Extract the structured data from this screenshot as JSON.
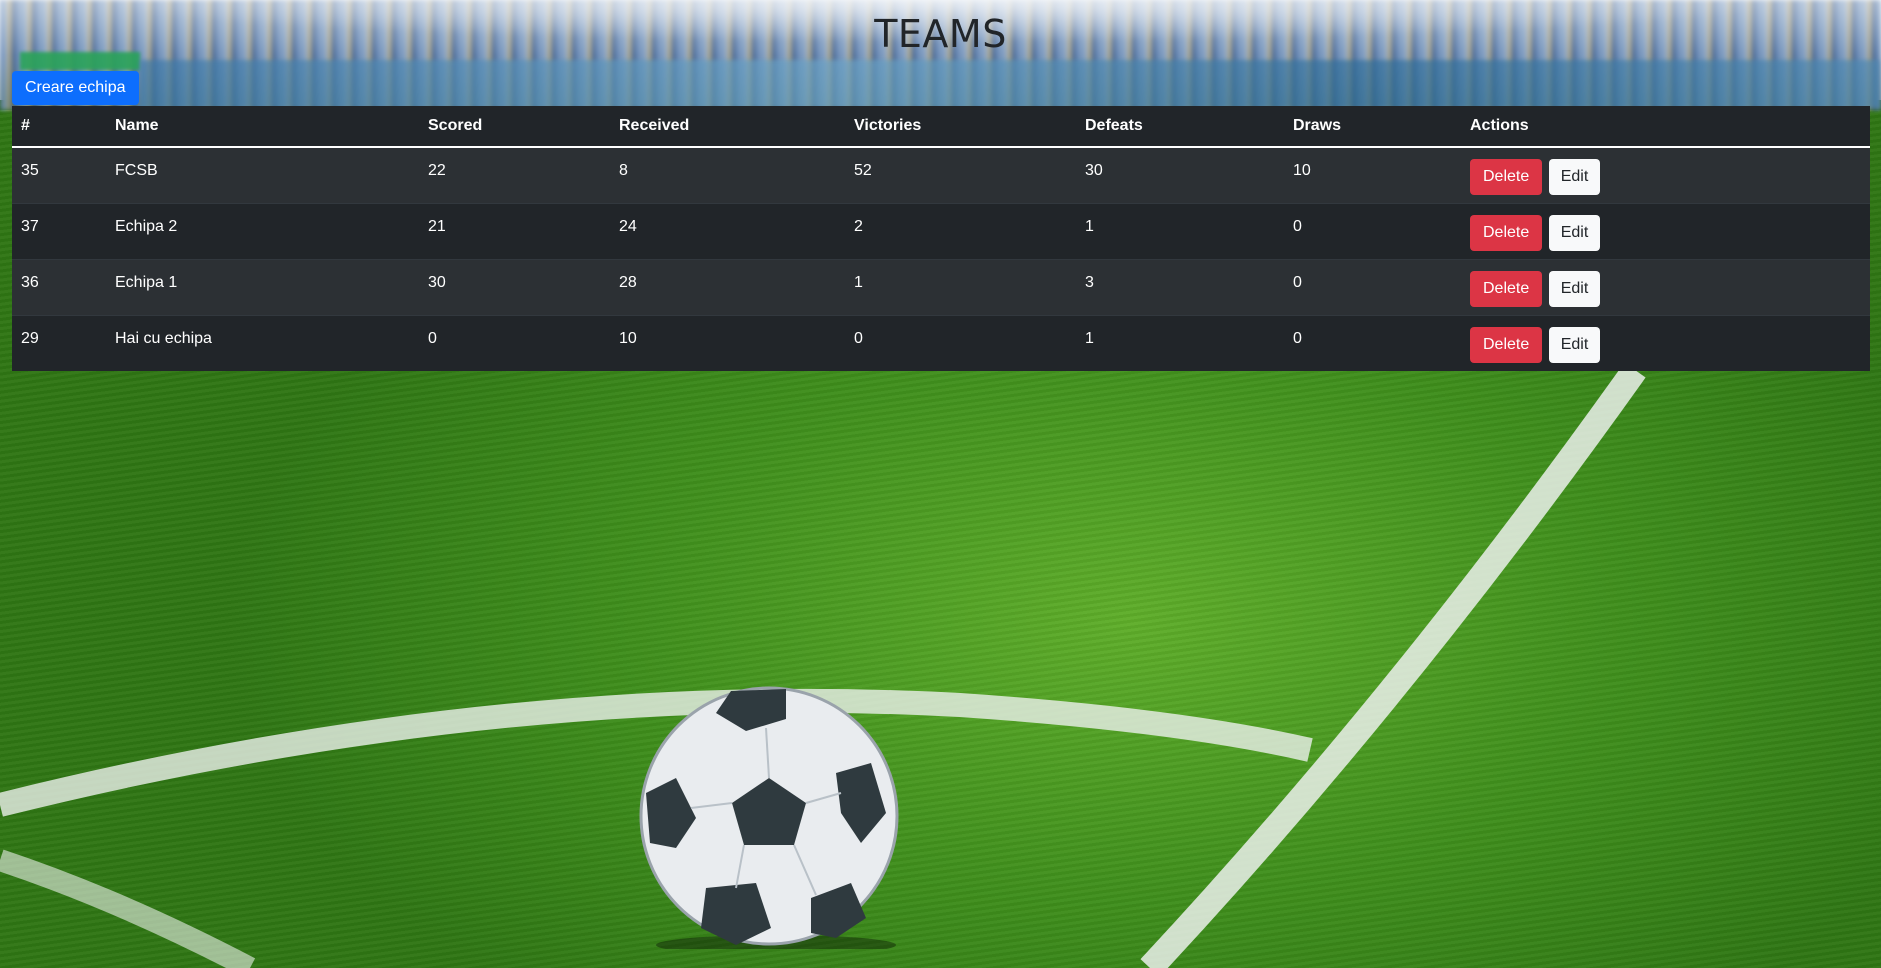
{
  "page": {
    "title": "TEAMS",
    "create_button_label": "Creare echipa"
  },
  "table": {
    "headers": [
      "#",
      "Name",
      "Scored",
      "Received",
      "Victories",
      "Defeats",
      "Draws",
      "Actions"
    ],
    "rows": [
      {
        "id": "35",
        "name": "FCSB",
        "scored": "22",
        "received": "8",
        "victories": "52",
        "defeats": "30",
        "draws": "10"
      },
      {
        "id": "37",
        "name": "Echipa 2",
        "scored": "21",
        "received": "24",
        "victories": "2",
        "defeats": "1",
        "draws": "0"
      },
      {
        "id": "36",
        "name": "Echipa 1",
        "scored": "30",
        "received": "28",
        "victories": "1",
        "defeats": "3",
        "draws": "0"
      },
      {
        "id": "29",
        "name": "Hai cu echipa",
        "scored": "0",
        "received": "10",
        "victories": "0",
        "defeats": "1",
        "draws": "0"
      }
    ],
    "delete_label": "Delete",
    "edit_label": "Edit"
  },
  "colors": {
    "primary": "#0d6efd",
    "danger": "#dc3545",
    "light": "#f8f9fa",
    "table_dark": "#212529",
    "table_stripe": "#2c3034"
  },
  "background": {
    "icon": "stadium-pitch-soccer-ball"
  }
}
